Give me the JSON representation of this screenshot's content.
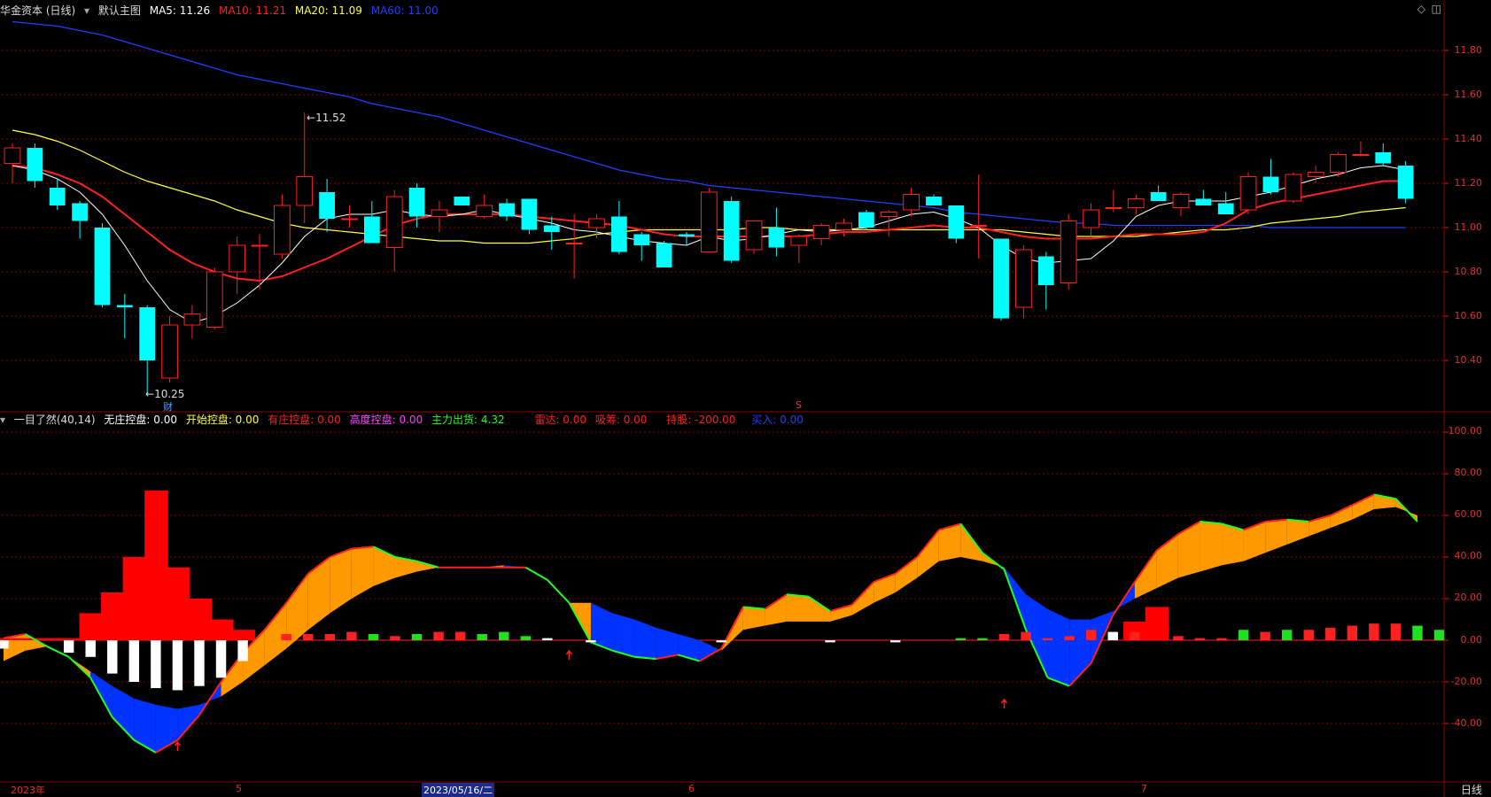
{
  "main_panel": {
    "stock_name": "华金资本 (日线)",
    "template": "默认主图",
    "ma": [
      {
        "label": "MA5: 11.26",
        "color": "#ffffff"
      },
      {
        "label": "MA10: 11.21",
        "color": "#ff2020"
      },
      {
        "label": "MA20: 11.09",
        "color": "#ffff40"
      },
      {
        "label": "MA60: 11.00",
        "color": "#2040ff"
      }
    ],
    "price_axis": [
      "11.80",
      "11.60",
      "11.40",
      "11.20",
      "11.00",
      "10.80",
      "10.60",
      "10.40"
    ],
    "high_marker": "11.52",
    "low_marker": "10.25",
    "finance_marker": "财",
    "s_marker": "S"
  },
  "indicator_panel": {
    "name": "一目了然(40,14)",
    "fields": [
      {
        "label": "无庄控盘: 0.00",
        "color": "#ffffff"
      },
      {
        "label": "开始控盘: 0.00",
        "color": "#ffff40"
      },
      {
        "label": "有庄控盘: 0.00",
        "color": "#ff2020"
      },
      {
        "label": "高度控盘: 0.00",
        "color": "#ff40ff"
      },
      {
        "label": "主力出货: 4.32",
        "color": "#20ff20"
      },
      {
        "label": "雷达: 0.00",
        "color": "#ff2020"
      },
      {
        "label": "吸筹: 0.00",
        "color": "#ff2020"
      },
      {
        "label": "持股: -200.00",
        "color": "#ff2020"
      },
      {
        "label": "买入: 0.00",
        "color": "#2040ff"
      }
    ],
    "axis": [
      "100.00",
      "80.00",
      "60.00",
      "40.00",
      "20.00",
      "0.00",
      "-20.00",
      "-40.00"
    ]
  },
  "time_axis": {
    "labels": [
      "2023年",
      "5",
      "2023/05/16/二",
      "6",
      "7"
    ],
    "period": "日线"
  },
  "candles": [
    {
      "o": 11.29,
      "h": 11.38,
      "l": 11.2,
      "c": 11.36
    },
    {
      "o": 11.36,
      "h": 11.38,
      "l": 11.18,
      "c": 11.21
    },
    {
      "o": 11.18,
      "h": 11.22,
      "l": 11.08,
      "c": 11.1
    },
    {
      "o": 11.11,
      "h": 11.12,
      "l": 10.95,
      "c": 11.03
    },
    {
      "o": 11.0,
      "h": 11.02,
      "l": 10.64,
      "c": 10.65
    },
    {
      "o": 10.65,
      "h": 10.7,
      "l": 10.5,
      "c": 10.64
    },
    {
      "o": 10.64,
      "h": 10.65,
      "l": 10.25,
      "c": 10.4
    },
    {
      "o": 10.32,
      "h": 10.6,
      "l": 10.3,
      "c": 10.56
    },
    {
      "o": 10.56,
      "h": 10.65,
      "l": 10.5,
      "c": 10.61
    },
    {
      "o": 10.55,
      "h": 10.82,
      "l": 10.54,
      "c": 10.8
    },
    {
      "o": 10.8,
      "h": 10.96,
      "l": 10.7,
      "c": 10.92
    },
    {
      "o": 10.92,
      "h": 10.97,
      "l": 10.72,
      "c": 10.92
    },
    {
      "o": 10.88,
      "h": 11.15,
      "l": 10.86,
      "c": 11.1
    },
    {
      "o": 11.1,
      "h": 11.52,
      "l": 11.02,
      "c": 11.23
    },
    {
      "o": 11.16,
      "h": 11.22,
      "l": 10.98,
      "c": 11.04
    },
    {
      "o": 11.04,
      "h": 11.1,
      "l": 11.0,
      "c": 11.04
    },
    {
      "o": 11.05,
      "h": 11.12,
      "l": 10.93,
      "c": 10.93
    },
    {
      "o": 10.91,
      "h": 11.17,
      "l": 10.8,
      "c": 11.14
    },
    {
      "o": 11.18,
      "h": 11.2,
      "l": 11.0,
      "c": 11.05
    },
    {
      "o": 11.05,
      "h": 11.12,
      "l": 10.98,
      "c": 11.08
    },
    {
      "o": 11.14,
      "h": 11.14,
      "l": 11.1,
      "c": 11.1
    },
    {
      "o": 11.05,
      "h": 11.15,
      "l": 11.04,
      "c": 11.1
    },
    {
      "o": 11.11,
      "h": 11.13,
      "l": 11.03,
      "c": 11.05
    },
    {
      "o": 11.13,
      "h": 11.13,
      "l": 10.97,
      "c": 10.99
    },
    {
      "o": 11.01,
      "h": 11.05,
      "l": 10.9,
      "c": 10.98
    },
    {
      "o": 10.93,
      "h": 11.06,
      "l": 10.77,
      "c": 10.93
    },
    {
      "o": 11.0,
      "h": 11.06,
      "l": 10.95,
      "c": 11.04
    },
    {
      "o": 11.05,
      "h": 11.12,
      "l": 10.88,
      "c": 10.89
    },
    {
      "o": 10.97,
      "h": 10.98,
      "l": 10.85,
      "c": 10.92
    },
    {
      "o": 10.93,
      "h": 10.94,
      "l": 10.82,
      "c": 10.82
    },
    {
      "o": 10.97,
      "h": 10.98,
      "l": 10.92,
      "c": 10.96
    },
    {
      "o": 10.89,
      "h": 11.18,
      "l": 10.89,
      "c": 11.16
    },
    {
      "o": 11.12,
      "h": 11.14,
      "l": 10.84,
      "c": 10.85
    },
    {
      "o": 10.9,
      "h": 11.03,
      "l": 10.88,
      "c": 11.03
    },
    {
      "o": 11.0,
      "h": 11.09,
      "l": 10.87,
      "c": 10.91
    },
    {
      "o": 10.92,
      "h": 10.97,
      "l": 10.84,
      "c": 10.96
    },
    {
      "o": 10.95,
      "h": 11.02,
      "l": 10.92,
      "c": 11.01
    },
    {
      "o": 10.99,
      "h": 11.04,
      "l": 10.96,
      "c": 11.02
    },
    {
      "o": 11.07,
      "h": 11.08,
      "l": 10.99,
      "c": 11.0
    },
    {
      "o": 11.05,
      "h": 11.08,
      "l": 10.96,
      "c": 11.07
    },
    {
      "o": 11.08,
      "h": 11.18,
      "l": 11.05,
      "c": 11.15
    },
    {
      "o": 11.14,
      "h": 11.15,
      "l": 11.1,
      "c": 11.1
    },
    {
      "o": 11.1,
      "h": 11.1,
      "l": 10.93,
      "c": 10.95
    },
    {
      "o": 11.01,
      "h": 11.24,
      "l": 10.86,
      "c": 11.01
    },
    {
      "o": 10.95,
      "h": 10.95,
      "l": 10.58,
      "c": 10.59
    },
    {
      "o": 10.64,
      "h": 10.92,
      "l": 10.59,
      "c": 10.9
    },
    {
      "o": 10.87,
      "h": 10.89,
      "l": 10.63,
      "c": 10.74
    },
    {
      "o": 10.75,
      "h": 11.06,
      "l": 10.72,
      "c": 11.03
    },
    {
      "o": 11.0,
      "h": 11.11,
      "l": 10.96,
      "c": 11.08
    },
    {
      "o": 11.09,
      "h": 11.17,
      "l": 11.07,
      "c": 11.09
    },
    {
      "o": 11.09,
      "h": 11.15,
      "l": 11.06,
      "c": 11.13
    },
    {
      "o": 11.16,
      "h": 11.19,
      "l": 11.13,
      "c": 11.12
    },
    {
      "o": 11.09,
      "h": 11.16,
      "l": 11.05,
      "c": 11.15
    },
    {
      "o": 11.13,
      "h": 11.17,
      "l": 11.1,
      "c": 11.1
    },
    {
      "o": 11.11,
      "h": 11.16,
      "l": 11.06,
      "c": 11.06
    },
    {
      "o": 11.08,
      "h": 11.25,
      "l": 11.06,
      "c": 11.23
    },
    {
      "o": 11.23,
      "h": 11.31,
      "l": 11.15,
      "c": 11.16
    },
    {
      "o": 11.12,
      "h": 11.25,
      "l": 11.11,
      "c": 11.24
    },
    {
      "o": 11.23,
      "h": 11.28,
      "l": 11.2,
      "c": 11.25
    },
    {
      "o": 11.25,
      "h": 11.34,
      "l": 11.23,
      "c": 11.33
    },
    {
      "o": 11.33,
      "h": 11.39,
      "l": 11.32,
      "c": 11.33
    },
    {
      "o": 11.34,
      "h": 11.38,
      "l": 11.28,
      "c": 11.29
    },
    {
      "o": 11.28,
      "h": 11.3,
      "l": 11.11,
      "c": 11.13
    }
  ],
  "ma_series": {
    "ma5": [
      11.28,
      11.26,
      11.22,
      11.16,
      11.06,
      10.92,
      10.76,
      10.63,
      10.57,
      10.6,
      10.66,
      10.74,
      10.84,
      10.96,
      11.04,
      11.06,
      11.06,
      11.08,
      11.06,
      11.05,
      11.06,
      11.08,
      11.06,
      11.04,
      11.02,
      10.99,
      10.98,
      10.96,
      10.94,
      10.93,
      10.92,
      10.96,
      10.94,
      10.95,
      10.97,
      10.99,
      10.98,
      10.99,
      11.0,
      11.03,
      11.06,
      11.07,
      11.04,
      11.0,
      10.92,
      10.86,
      10.84,
      10.85,
      10.86,
      10.94,
      11.05,
      11.1,
      11.12,
      11.12,
      11.12,
      11.14,
      11.16,
      11.19,
      11.22,
      11.24,
      11.27,
      11.28,
      11.26
    ],
    "ma10": [
      11.28,
      11.27,
      11.24,
      11.2,
      11.14,
      11.06,
      10.98,
      10.9,
      10.84,
      10.8,
      10.77,
      10.76,
      10.78,
      10.82,
      10.86,
      10.91,
      10.96,
      11.01,
      11.04,
      11.06,
      11.06,
      11.06,
      11.06,
      11.05,
      11.04,
      11.03,
      11.02,
      11.01,
      10.99,
      10.97,
      10.96,
      10.96,
      10.96,
      10.96,
      10.96,
      10.96,
      10.97,
      10.98,
      10.98,
      10.99,
      11.0,
      11.01,
      11.0,
      11.0,
      10.98,
      10.96,
      10.95,
      10.95,
      10.95,
      10.96,
      10.97,
      10.97,
      10.97,
      10.98,
      11.02,
      11.08,
      11.11,
      11.13,
      11.15,
      11.17,
      11.19,
      11.21,
      11.21
    ],
    "ma20": [
      11.44,
      11.42,
      11.39,
      11.35,
      11.3,
      11.25,
      11.21,
      11.18,
      11.15,
      11.12,
      11.08,
      11.05,
      11.02,
      11.0,
      10.99,
      10.98,
      10.97,
      10.96,
      10.95,
      10.94,
      10.94,
      10.93,
      10.93,
      10.93,
      10.94,
      10.95,
      10.97,
      10.98,
      10.99,
      10.99,
      10.99,
      10.99,
      10.99,
      11.0,
      11.0,
      10.99,
      10.99,
      10.99,
      10.99,
      10.99,
      10.99,
      10.99,
      10.99,
      10.99,
      10.99,
      10.98,
      10.97,
      10.96,
      10.96,
      10.96,
      10.96,
      10.97,
      10.98,
      10.99,
      10.99,
      11.0,
      11.02,
      11.03,
      11.04,
      11.05,
      11.07,
      11.08,
      11.09
    ],
    "ma60": [
      11.93,
      11.92,
      11.91,
      11.89,
      11.87,
      11.84,
      11.81,
      11.78,
      11.75,
      11.72,
      11.69,
      11.67,
      11.65,
      11.63,
      11.61,
      11.59,
      11.56,
      11.54,
      11.52,
      11.5,
      11.47,
      11.44,
      11.41,
      11.38,
      11.35,
      11.32,
      11.29,
      11.26,
      11.24,
      11.22,
      11.21,
      11.19,
      11.18,
      11.17,
      11.16,
      11.15,
      11.14,
      11.13,
      11.12,
      11.11,
      11.1,
      11.09,
      11.07,
      11.06,
      11.05,
      11.04,
      11.03,
      11.02,
      11.02,
      11.01,
      11.01,
      11.01,
      11.01,
      11.01,
      11.01,
      11.01,
      11.0,
      11.0,
      11.0,
      11.0,
      11.0,
      11.0,
      11.0
    ]
  },
  "indicator_series": {
    "upper": [
      1,
      3,
      -3,
      -8,
      -18,
      -37,
      -48,
      -54,
      -48,
      -36,
      -20,
      -6,
      5,
      18,
      32,
      40,
      44,
      45,
      40,
      38,
      35,
      35,
      35,
      35,
      35,
      29,
      18,
      -1,
      -5,
      -8,
      -9,
      -7,
      -10,
      -4,
      16,
      15,
      22,
      21,
      14,
      17,
      28,
      32,
      40,
      53,
      56,
      42,
      34,
      5,
      -18,
      -22,
      -11,
      12,
      28,
      43,
      51,
      57,
      56,
      53,
      57,
      58,
      57,
      60,
      65,
      70,
      68,
      57
    ],
    "lower": [
      -10,
      -5,
      -3,
      -8,
      -15,
      -22,
      -28,
      -31,
      -33,
      -31,
      -27,
      -20,
      -12,
      -4,
      5,
      13,
      20,
      26,
      30,
      33,
      35,
      35,
      35,
      36,
      35,
      29,
      18,
      18,
      13,
      10,
      6,
      3,
      0,
      -5,
      5,
      7,
      9,
      9,
      9,
      12,
      18,
      23,
      30,
      38,
      40,
      38,
      35,
      22,
      15,
      10,
      10,
      14,
      20,
      25,
      30,
      33,
      36,
      38,
      42,
      46,
      50,
      54,
      58,
      63,
      64,
      60
    ],
    "bars": [
      -4,
      0,
      0,
      -6,
      -8,
      -16,
      -20,
      -23,
      -24,
      -22,
      -18,
      -10,
      0,
      3,
      3,
      3,
      4,
      3,
      2,
      3,
      4,
      4,
      3,
      4,
      2,
      1,
      0,
      -1,
      0,
      0,
      0,
      0,
      0,
      -1,
      0,
      0,
      0,
      0,
      -1,
      0,
      0,
      -1,
      0,
      0,
      1,
      1,
      3,
      4,
      1,
      2,
      5,
      4,
      4,
      0,
      2,
      1,
      1,
      5,
      4,
      5,
      5,
      6,
      7,
      8,
      8,
      7,
      5
    ],
    "bar_colors": [
      "w",
      "w",
      "w",
      "w",
      "w",
      "w",
      "w",
      "w",
      "w",
      "w",
      "w",
      "w",
      "r",
      "r",
      "r",
      "r",
      "r",
      "g",
      "r",
      "g",
      "r",
      "r",
      "g",
      "g",
      "g",
      "w",
      "w",
      "w",
      "w",
      "w",
      "w",
      "w",
      "w",
      "w",
      "w",
      "w",
      "w",
      "w",
      "w",
      "w",
      "w",
      "w",
      "r",
      "r",
      "g",
      "g",
      "r",
      "r",
      "r",
      "r",
      "r",
      "w",
      "r",
      "r",
      "r",
      "r",
      "r",
      "g",
      "r",
      "g",
      "r",
      "r",
      "r",
      "r",
      "r",
      "g",
      "g"
    ],
    "red_blocks": [
      1,
      1,
      1,
      1,
      13,
      23,
      40,
      72,
      35,
      20,
      10,
      5,
      0,
      0,
      0,
      0,
      0,
      0,
      0,
      0,
      0,
      0,
      0,
      0,
      0,
      0,
      0,
      0,
      0,
      0,
      0,
      0,
      0,
      0,
      0,
      0,
      0,
      0,
      0,
      0,
      0,
      0,
      0,
      0,
      0,
      0,
      0,
      0,
      0,
      0,
      0,
      0,
      9,
      16,
      0,
      0,
      0,
      0,
      0,
      0,
      0,
      0,
      0,
      0,
      0,
      0
    ]
  },
  "colors": {
    "bull": "#ff2020",
    "bear": "#00ffff",
    "ma5": "#ffffff",
    "ma10": "#ff2020",
    "ma20": "#ffff40",
    "ma60": "#2040ff",
    "grid": "#8a0000",
    "orange": "#ff9900",
    "blue_fill": "#0033ff"
  }
}
